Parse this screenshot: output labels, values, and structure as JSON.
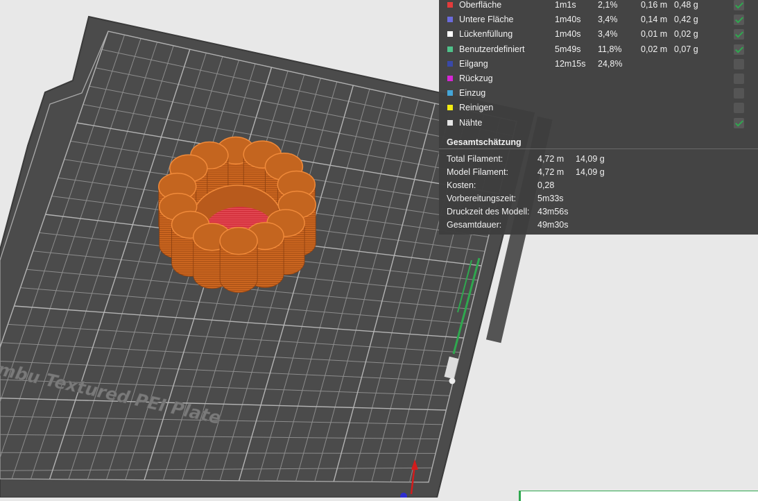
{
  "colors": {
    "background": "#e8e8e8",
    "plate": "#4b4b4b",
    "grid": "#8c8c8c",
    "model": "#c0601a",
    "top_surface": "#d9313d",
    "panel": "#3e3e3e",
    "accent": "#2fa84f"
  },
  "plate": {
    "label": "Bambu Textured PEI Plate"
  },
  "legend": [
    {
      "name": "Oberfläche",
      "time": "1m1s",
      "percent": "2,1%",
      "length": "0,16 m",
      "weight": "0,48 g",
      "color": "#e33b3b",
      "checked": true
    },
    {
      "name": "Untere Fläche",
      "time": "1m40s",
      "percent": "3,4%",
      "length": "0,14 m",
      "weight": "0,42 g",
      "color": "#6b6bdc",
      "checked": true
    },
    {
      "name": "Lückenfüllung",
      "time": "1m40s",
      "percent": "3,4%",
      "length": "0,01 m",
      "weight": "0,02 g",
      "color": "#ffffff",
      "checked": true
    },
    {
      "name": "Benutzerdefiniert",
      "time": "5m49s",
      "percent": "11,8%",
      "length": "0,02 m",
      "weight": "0,07 g",
      "color": "#4fc28a",
      "checked": true
    },
    {
      "name": "Eilgang",
      "time": "12m15s",
      "percent": "24,8%",
      "length": "",
      "weight": "",
      "color": "#3949a8",
      "checked": false
    },
    {
      "name": "Rückzug",
      "time": "",
      "percent": "",
      "length": "",
      "weight": "",
      "color": "#d526d5",
      "checked": false
    },
    {
      "name": "Einzug",
      "time": "",
      "percent": "",
      "length": "",
      "weight": "",
      "color": "#44a6d8",
      "checked": false
    },
    {
      "name": "Reinigen",
      "time": "",
      "percent": "",
      "length": "",
      "weight": "",
      "color": "#f2ec12",
      "checked": false
    },
    {
      "name": "Nähte",
      "time": "",
      "percent": "",
      "length": "",
      "weight": "",
      "color": "#e6e6e6",
      "checked": true
    }
  ],
  "summary": {
    "title": "Gesamtschätzung",
    "rows": [
      {
        "label": "Total Filament:",
        "value": "4,72 m",
        "extra": "14,09 g"
      },
      {
        "label": "Model Filament:",
        "value": "4,72 m",
        "extra": "14,09 g"
      },
      {
        "label": "Kosten:",
        "value": "0,28",
        "extra": ""
      },
      {
        "label": "Vorbereitungszeit:",
        "value": "5m33s",
        "extra": ""
      },
      {
        "label": "Druckzeit des Modell:",
        "value": "43m56s",
        "extra": ""
      },
      {
        "label": "Gesamtdauer:",
        "value": "49m30s",
        "extra": ""
      }
    ]
  }
}
